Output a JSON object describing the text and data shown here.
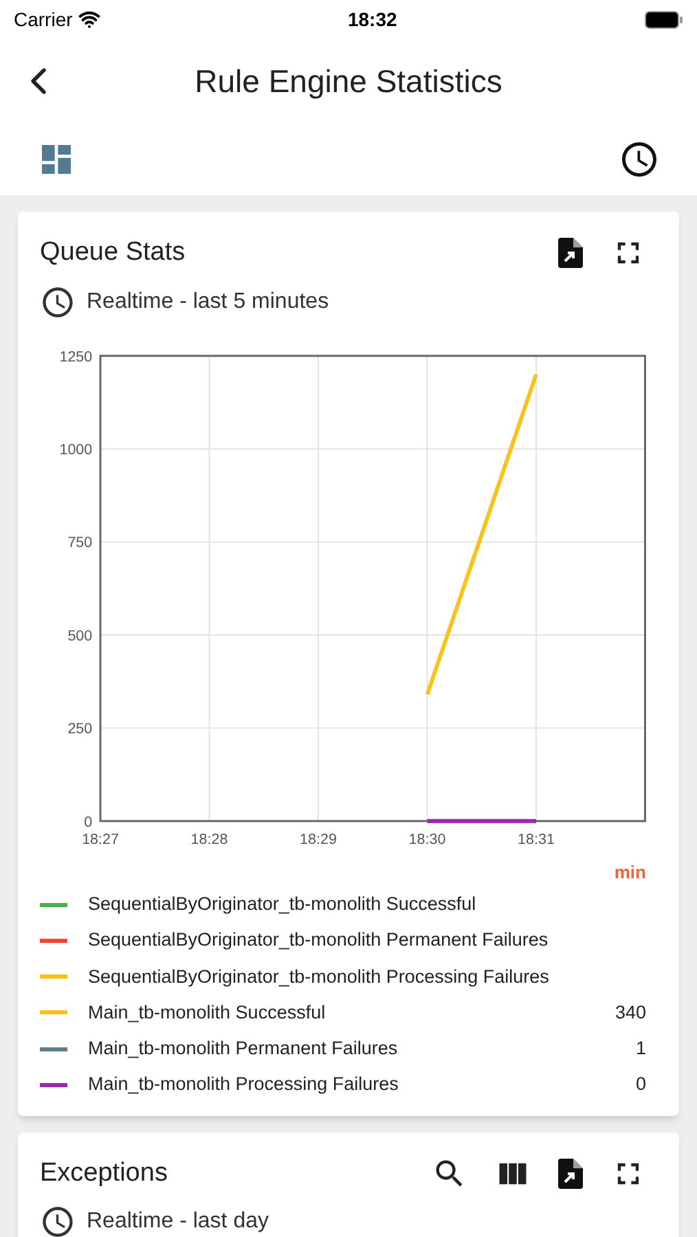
{
  "status_bar": {
    "carrier": "Carrier",
    "time": "18:32"
  },
  "nav": {
    "title": "Rule Engine Statistics"
  },
  "widgets": [
    {
      "title": "Queue Stats",
      "timewindow": "Realtime - last 5 minutes",
      "chart_data": {
        "type": "line",
        "categories": [
          "18:27",
          "18:28",
          "18:29",
          "18:30",
          "18:31"
        ],
        "ylim": [
          0,
          1250
        ],
        "yticks": [
          0,
          250,
          500,
          750,
          1000,
          1250
        ],
        "grid": true,
        "series": [
          {
            "name": "SequentialByOriginator_tb-monolith Successful",
            "color": "#4caf50",
            "values": [
              null,
              null,
              null,
              null,
              null
            ]
          },
          {
            "name": "SequentialByOriginator_tb-monolith Permanent Failures",
            "color": "#f44336",
            "values": [
              null,
              null,
              null,
              null,
              null
            ]
          },
          {
            "name": "SequentialByOriginator_tb-monolith Processing Failures",
            "color": "#ffc107",
            "values": [
              null,
              null,
              null,
              null,
              null
            ]
          },
          {
            "name": "Main_tb-monolith Successful",
            "color": "#fbc21b",
            "values": [
              null,
              null,
              null,
              340,
              1200
            ]
          },
          {
            "name": "Main_tb-monolith Permanent Failures",
            "color": "#607d8b",
            "values": [
              null,
              null,
              null,
              null,
              null
            ]
          },
          {
            "name": "Main_tb-monolith Processing Failures",
            "color": "#9c27b0",
            "values": [
              null,
              null,
              null,
              0,
              0
            ]
          }
        ]
      },
      "legend_header": "min",
      "legend_values": [
        "340",
        "1",
        "0"
      ],
      "actions": [
        {
          "kind": "export"
        },
        {
          "kind": "fullscreen"
        }
      ]
    },
    {
      "title": "Exceptions",
      "timewindow": "Realtime - last day",
      "actions": [
        {
          "kind": "search"
        },
        {
          "kind": "columns"
        },
        {
          "kind": "export"
        },
        {
          "kind": "fullscreen"
        }
      ]
    }
  ]
}
